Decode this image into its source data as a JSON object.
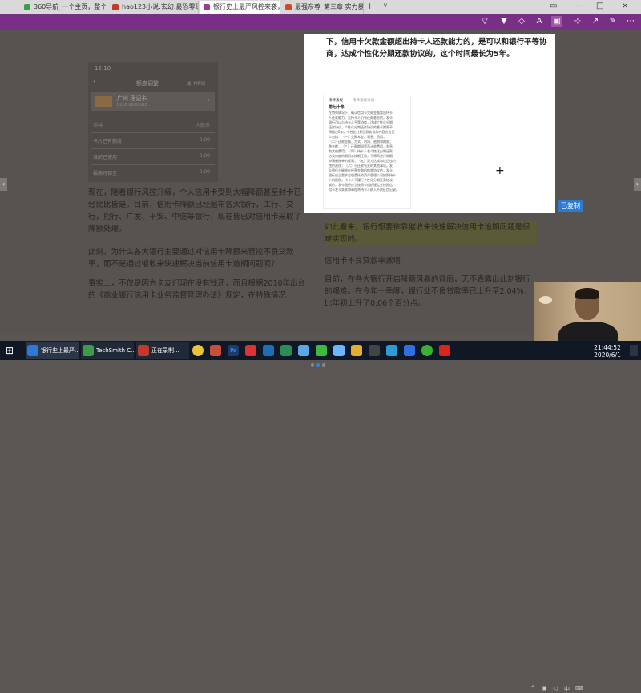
{
  "browser": {
    "tabs": [
      {
        "title": "360导航_一个主页，整个世",
        "active": false,
        "color": "#3aa14a"
      },
      {
        "title": "hao123小说:玄幻:最恐零珠",
        "active": false,
        "color": "#c23a2c"
      },
      {
        "title": "银行史上最严风控来袭，",
        "active": true,
        "color": "#9b3c8e"
      },
      {
        "title": "最强帝尊_第三章 实力暴涨",
        "active": false,
        "color": "#d04a2a"
      }
    ],
    "new_tab": "+",
    "tab_list": "∨"
  },
  "phone": {
    "time": "12:10",
    "title": "额度调整",
    "right_link": "最卡明细",
    "card_name": "广州 理记卡",
    "card_no": "6218 0600 018",
    "rows": [
      {
        "label": "币种",
        "value": "人民币"
      },
      {
        "label": "卡片已有额度",
        "value": "0.00"
      },
      {
        "label": "当前已使用",
        "value": "0.00"
      },
      {
        "label": "最高可调至",
        "value": "0.00"
      }
    ]
  },
  "left_paragraphs": [
    "现在，随着银行风控升级，个人信用卡受到大幅降额甚至封卡已经比比皆是。目前，信用卡降额已经遍布各大银行，工行、交行，招行、广发、平安、中信等银行，现在皆已对信用卡采取了降额处理。",
    "此刻，为什么各大银行主要通过对信用卡降额来管控不良贷款率，而不是通过催收来快速解决当前信用卡逾期问题呢？",
    "事实上，不仅是因为卡友们现在没有钱还，而且根据2010年出台的《商业银行信用卡业务监督管理办法》规定，在特殊情况"
  ],
  "right_paragraphs": [
    "如此看来，银行想要依靠催收来快速解决信用卡逾期问题是很难实现的。",
    "信用卡不良贷款率激增",
    "目前，在各大银行开启降额风暴的背后，无不表露出此刻银行的艰难。在今年一季度，银行业不良贷款率已上升至2.04%，比年初上升了0.06个百分点。"
  ],
  "overlay": {
    "text": "下，信用卡欠款金额超出持卡人还款能力的，是可以和银行平等协商，达成个性化分期还款协议的，这个时间最长为5年。",
    "image_header": [
      "法律法规",
      "法律法规详情"
    ],
    "image_title": "第七十条",
    "image_lines": [
      "在特殊情况下，确认信用卡欠款金额超出持卡",
      "人还款能力，且持卡人仍有还款意愿的，发卡",
      "银行可以与持卡人平等协商，达成个性化分期",
      "还款协议。个性化分期还款协议的最长期限不",
      "得超过5年。个性化分期还款协议的内容应当至",
      "少包括：（一）欠款本金、利息、费用；",
      "（二）还款金额、方式、时间、逾期和期限；",
      "数金额；（三）还款期间是否计收费用，利息",
      "和其他费用；（四）持卡人若个性化分期还款",
      "协议约定的期间未按期还款，不得再进行增期",
      "申请新账单的权利；（五）双方达成和议后违约",
      "违约责任；（六）与还款有关的其他事项。发",
      "卡银行与催收在经营金融机构就协议的，发卡",
      "银行应当要求全权委托的资产管理公司按照持卡",
      "人的报税，持卡人不履行个性化分期还款协议",
      "或的，发卡银行应当按照卡组织规定并按照信",
      "用卡发卡条款和章程将持卡人纳入不良征信记录。"
    ],
    "tag": "已复制"
  },
  "taskbar": {
    "items": [
      {
        "label": "银行史上最严...",
        "color": "#2c7ad6"
      },
      {
        "label": "TechSmith C...",
        "color": "#3d9c4a"
      },
      {
        "label": "正在录制...",
        "color": "#c0392b"
      }
    ],
    "clock_time": "21:44:52",
    "clock_date": "2020/6/1"
  }
}
